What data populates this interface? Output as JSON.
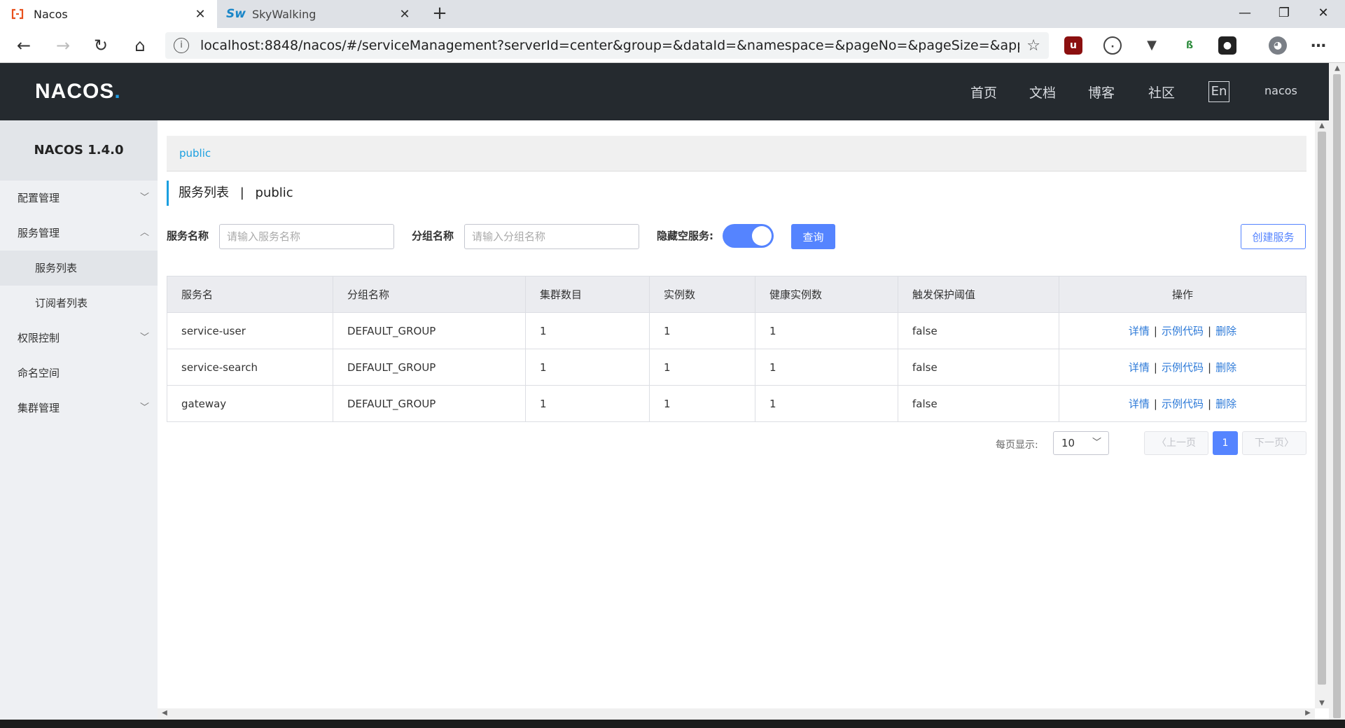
{
  "browser": {
    "tabs": [
      {
        "title": "Nacos",
        "icon": "nacos-favicon"
      },
      {
        "title": "SkyWalking",
        "icon": "skywalking-favicon",
        "favicon_text": "Sw"
      }
    ],
    "url": "localhost:8848/nacos/#/serviceManagement?serverId=center&group=&dataId=&namespace=&pageNo=&pageSize=&appNam..."
  },
  "header": {
    "logo": "NACOS",
    "nav": [
      "首页",
      "文档",
      "博客",
      "社区"
    ],
    "lang": "En",
    "user": "nacos"
  },
  "sidebar": {
    "version": "NACOS 1.4.0",
    "items": [
      {
        "label": "配置管理",
        "expand": "down"
      },
      {
        "label": "服务管理",
        "expand": "up"
      },
      {
        "label": "服务列表",
        "sub": true,
        "selected": true
      },
      {
        "label": "订阅者列表",
        "sub": true
      },
      {
        "label": "权限控制",
        "expand": "down"
      },
      {
        "label": "命名空间"
      },
      {
        "label": "集群管理",
        "expand": "down"
      }
    ]
  },
  "breadcrumb": {
    "namespace": "public"
  },
  "page": {
    "title": "服务列表",
    "separator": "|",
    "namespace": "public"
  },
  "filters": {
    "service_name_label": "服务名称",
    "service_name_placeholder": "请输入服务名称",
    "group_name_label": "分组名称",
    "group_name_placeholder": "请输入分组名称",
    "hide_empty_label": "隐藏空服务:",
    "hide_empty_on": true,
    "query_button": "查询",
    "create_button": "创建服务"
  },
  "table": {
    "columns": [
      "服务名",
      "分组名称",
      "集群数目",
      "实例数",
      "健康实例数",
      "触发保护阈值",
      "操作"
    ],
    "rows": [
      {
        "name": "service-user",
        "group": "DEFAULT_GROUP",
        "clusters": "1",
        "instances": "1",
        "healthy": "1",
        "threshold": "false"
      },
      {
        "name": "service-search",
        "group": "DEFAULT_GROUP",
        "clusters": "1",
        "instances": "1",
        "healthy": "1",
        "threshold": "false"
      },
      {
        "name": "gateway",
        "group": "DEFAULT_GROUP",
        "clusters": "1",
        "instances": "1",
        "healthy": "1",
        "threshold": "false"
      }
    ],
    "actions": {
      "detail": "详情",
      "sample": "示例代码",
      "delete": "删除",
      "sep": "|"
    }
  },
  "pagination": {
    "per_page_label": "每页显示:",
    "page_size": "10",
    "prev": "上一页",
    "next": "下一页",
    "current": "1"
  },
  "colors": {
    "accent": "#5584ff",
    "header_bg": "#252a2f",
    "link": "#2d7ad8",
    "breadcrumb": "#1a9fe0"
  }
}
